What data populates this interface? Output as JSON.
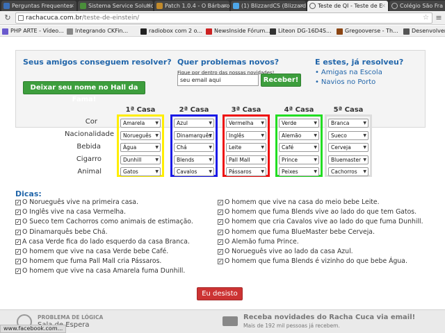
{
  "browser": {
    "tabs": [
      {
        "label": "Perguntas Frequentes",
        "icon_color": "#3b6fb6"
      },
      {
        "label": "Sistema Service Solutio",
        "icon_color": "#4a8f3a"
      },
      {
        "label": "Patch 1.0.4 - O Bárbaro",
        "icon_color": "#c28a2a"
      },
      {
        "label": "(1) BlizzardCS (Blizzard)",
        "icon_color": "#4da6e8"
      },
      {
        "label": "Teste de QI - Teste de E",
        "icon_color": "#555555",
        "active": true
      },
      {
        "label": "Colégio São Fra",
        "icon_color": "#555555"
      }
    ],
    "url_host": "rachacuca.com.br",
    "url_path": "/teste-de-einstein/",
    "bookmarks": [
      {
        "label": "PHP ARTE - Vídeo...",
        "icon_color": "#6a5acd"
      },
      {
        "label": "Integrando CKFin...",
        "icon_color": "#888888"
      },
      {
        "label": "radiobox com 2 o...",
        "icon_color": "#222222"
      },
      {
        "label": "NewsInside Fórum...",
        "icon_color": "#cc2222"
      },
      {
        "label": "Liteon DG-16D4S...",
        "icon_color": "#333333"
      },
      {
        "label": "Gregooverse - Th...",
        "icon_color": "#8b4513"
      },
      {
        "label": "Desenvolver",
        "icon_color": "#555555"
      }
    ]
  },
  "promo": {
    "col1_title": "Seus amigos conseguem resolver?",
    "hall_button": "Deixar seu nome no Hall da Fama!",
    "col2_title": "Quer problemas novos?",
    "col2_sub": "Fique por dentro das nossas novidades!",
    "email_value": "seu email aqui",
    "receive_button": "Receber!",
    "col3_title": "E estes, já resolveu?",
    "links": [
      "Amigas na Escola",
      "Navios no Porto"
    ]
  },
  "puzzle": {
    "row_labels": [
      "Cor",
      "Nacionalidade",
      "Bebida",
      "Cigarro",
      "Animal"
    ],
    "houses": [
      {
        "title": "1ª Casa",
        "color": "#ffee00",
        "values": [
          "Amarela",
          "Norueguês",
          "Água",
          "Dunhill",
          "Gatos"
        ]
      },
      {
        "title": "2ª Casa",
        "color": "#1a1ae6",
        "values": [
          "Azul",
          "Dinamarquês",
          "Chá",
          "Blends",
          "Cavalos"
        ]
      },
      {
        "title": "3ª Casa",
        "color": "#ee1111",
        "values": [
          "Vermelha",
          "Inglês",
          "Leite",
          "Pall Mall",
          "Pássaros"
        ]
      },
      {
        "title": "4ª Casa",
        "color": "#22dd22",
        "values": [
          "Verde",
          "Alemão",
          "Café",
          "Prince",
          "Peixes"
        ]
      },
      {
        "title": "5ª Casa",
        "color": "#dddddd",
        "values": [
          "Branca",
          "Sueco",
          "Cerveja",
          "Bluemaster",
          "Cachorros"
        ]
      }
    ]
  },
  "hints": {
    "title": "Dicas:",
    "left": [
      "O Norueguês vive na primeira casa.",
      "O Inglês vive na casa Vermelha.",
      "O Sueco tem Cachorros como animais de estimação.",
      "O Dinamarquês bebe Chá.",
      "A casa Verde fica do lado esquerdo da casa Branca.",
      "O homem que vive na casa Verde bebe Café.",
      "O homem que fuma Pall Mall cria Pássaros.",
      "O homem que vive na casa Amarela fuma Dunhill."
    ],
    "right": [
      "O homem que vive na casa do meio bebe Leite.",
      "O homem que fuma Blends vive ao lado do que tem Gatos.",
      "O homem que cria Cavalos vive ao lado do que fuma Dunhill.",
      "O homem que fuma BlueMaster bebe Cerveja.",
      "O Alemão fuma Prince.",
      "O Norueguês vive ao lado da casa Azul.",
      "O homem que fuma Blends é vizinho do que bebe Água."
    ]
  },
  "give_up_button": "Eu desisto",
  "footer": {
    "left_title": "PROBLEMA DE LÓGICA",
    "left_sub": "Sala de Espera",
    "right_title": "Receba novidades do Racha Cuca via email!",
    "right_sub": "Mais de 192 mil pessoas já recebem."
  },
  "status_text": "www.facebook.com..."
}
